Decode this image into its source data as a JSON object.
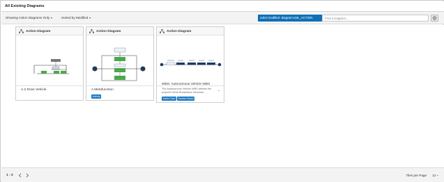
{
  "header": {
    "title": "All Existing Diagrams"
  },
  "toolbar": {
    "filter_dropdown": "Showing Action Diagrams Only",
    "sort_dropdown": "Sorted by Modified",
    "active_filter": "order:modified -diagram:LML_ACTION",
    "search": {
      "placeholder": "Find a Diagram...",
      "value": ""
    }
  },
  "tiles": [
    {
      "type_label": "Action Diagram",
      "name": "A.2 Drive Vehicle",
      "description": "",
      "badges": []
    },
    {
      "type_label": "Action Diagram",
      "name": "A Metafunction",
      "description": "",
      "badges": [
        "Activity"
      ]
    },
    {
      "type_label": "Action Diagram",
      "name": "WBS: Autonomous Vehicle WBS",
      "description": "The Autonomous Vehicle WBS defines the project's Work Breakdown Structure",
      "badges": [
        "Gantt Chart",
        "Kanban Board"
      ]
    }
  ],
  "footer": {
    "range": "1 - 3",
    "tiles_per_page_label": "Tiles per Page",
    "tiles_per_page_value": "12"
  },
  "colors": {
    "accent": "#0f6fb7",
    "badge": "#1a78c2",
    "node_green": "#4aa84a",
    "node_dark": "#1d3c63"
  },
  "icons": {
    "search": "search-icon",
    "diagram": "diagram-icon",
    "prev": "chevron-left-icon",
    "next": "chevron-right-icon"
  }
}
